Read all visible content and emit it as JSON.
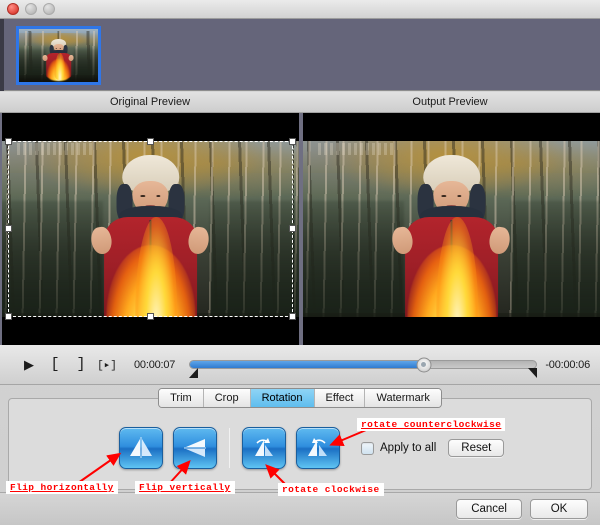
{
  "window": {
    "controls": [
      "close",
      "minimize",
      "maximize"
    ]
  },
  "thumbnails": [
    {
      "name": "clip-thumbnail-1",
      "selected": true
    }
  ],
  "preview": {
    "original_label": "Original Preview",
    "output_label": "Output Preview",
    "crop_marquee_visible": true
  },
  "transport": {
    "play_icon": "play-icon",
    "mark_in_icon": "[",
    "mark_out_icon": "]",
    "split_icon": "[▸]",
    "current_time": "00:00:07",
    "remaining_time": "-00:00:06",
    "progress_percent": 67.5
  },
  "tabs": [
    {
      "label": "Trim",
      "active": false
    },
    {
      "label": "Crop",
      "active": false
    },
    {
      "label": "Rotation",
      "active": true
    },
    {
      "label": "Effect",
      "active": false
    },
    {
      "label": "Watermark",
      "active": false
    }
  ],
  "rotation_panel": {
    "buttons": [
      {
        "name": "flip-horizontal-button",
        "icon": "flip-horizontal-icon"
      },
      {
        "name": "flip-vertical-button",
        "icon": "flip-vertical-icon"
      },
      {
        "name": "rotate-clockwise-button",
        "icon": "rotate-clockwise-icon"
      },
      {
        "name": "rotate-counterclockwise-button",
        "icon": "rotate-counterclockwise-icon"
      }
    ],
    "apply_to_all_label": "Apply to all",
    "apply_to_all_checked": false,
    "reset_label": "Reset"
  },
  "footer": {
    "cancel_label": "Cancel",
    "ok_label": "OK"
  },
  "annotations": [
    {
      "text": "Flip horizontally",
      "underline": true
    },
    {
      "text": "Flip vertically",
      "underline": true
    },
    {
      "text": "rotate clockwise",
      "underline": false
    },
    {
      "text": "rotate counterclockwise",
      "underline": true
    }
  ],
  "colors": {
    "accent_blue": "#2f7bd0",
    "tab_active": "#5fbdee",
    "annotation_red": "#ff0000",
    "thumb_strip_bg": "#65657a",
    "selection_border": "#2f76e8"
  }
}
